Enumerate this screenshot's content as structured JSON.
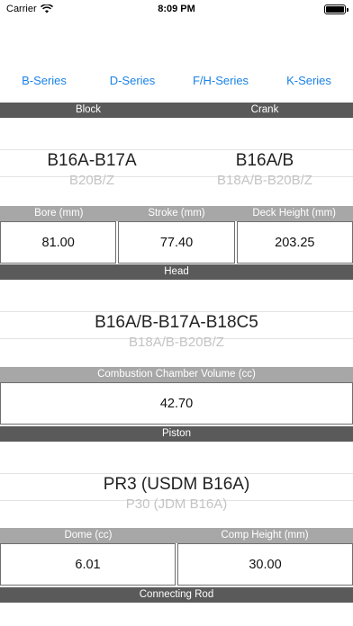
{
  "status_bar": {
    "carrier": "Carrier",
    "time": "8:09 PM"
  },
  "tabs": [
    "B-Series",
    "D-Series",
    "F/H-Series",
    "K-Series"
  ],
  "block_section": {
    "left_label": "Block",
    "right_label": "Crank",
    "block_picker": {
      "selected": "B16A-B17A",
      "next": "B20B/Z"
    },
    "crank_picker": {
      "selected": "B16A/B",
      "next": "B18A/B-B20B/Z"
    },
    "fields": [
      {
        "label": "Bore (mm)",
        "value": "81.00"
      },
      {
        "label": "Stroke (mm)",
        "value": "77.40"
      },
      {
        "label": "Deck Height (mm)",
        "value": "203.25"
      }
    ]
  },
  "head_section": {
    "label": "Head",
    "picker": {
      "selected": "B16A/B-B17A-B18C5",
      "next": "B18A/B-B20B/Z"
    },
    "field": {
      "label": "Combustion Chamber Volume (cc)",
      "value": "42.70"
    }
  },
  "piston_section": {
    "label": "Piston",
    "picker": {
      "selected": "PR3 (USDM B16A)",
      "next": "P30 (JDM B16A)"
    },
    "fields": [
      {
        "label": "Dome (cc)",
        "value": "6.01"
      },
      {
        "label": "Comp Height (mm)",
        "value": "30.00"
      }
    ]
  },
  "connecting_rod_section": {
    "label": "Connecting Rod"
  }
}
